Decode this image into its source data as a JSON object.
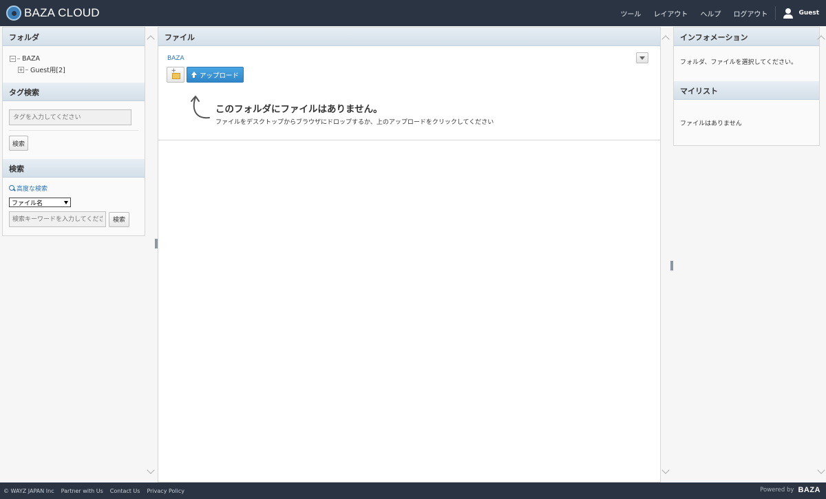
{
  "header": {
    "brand": "BAZA CLOUD",
    "nav": [
      "ツール",
      "レイアウト",
      "ヘルプ",
      "ログアウト"
    ],
    "user": "Guest"
  },
  "left": {
    "folder_title": "フォルダ",
    "tree": {
      "root": "BAZA",
      "child": "Guest用[2]"
    },
    "tag_title": "タグ検索",
    "tag_placeholder": "タグを入力してください",
    "tag_search_button": "検索",
    "search_title": "検索",
    "advanced_search": "高度な検索",
    "search_field_selected": "ファイル名",
    "keyword_placeholder": "検索キーワードを入力してください",
    "search_button": "検索"
  },
  "center": {
    "title": "ファイル",
    "breadcrumb": "BAZA",
    "upload_button": "アップロード",
    "empty_title": "このフォルダにファイルはありません。",
    "empty_sub": "ファイルをデスクトップからブラウザにドロップするか、上のアップロードをクリックしてください"
  },
  "right": {
    "info_title": "インフォメーション",
    "info_text": "フォルダ、ファイルを選択してください。",
    "mylist_title": "マイリスト",
    "mylist_text": "ファイルはありません"
  },
  "footer": {
    "links": [
      "© WAYZ JAPAN Inc",
      "Partner with Us",
      "Contact Us",
      "Privacy Policy"
    ],
    "powered_by": "Powered by",
    "powered_brand": "BAZA"
  },
  "colors": {
    "topbar": "#2a3443",
    "accent": "#2f86c8",
    "link": "#2a72b5"
  }
}
